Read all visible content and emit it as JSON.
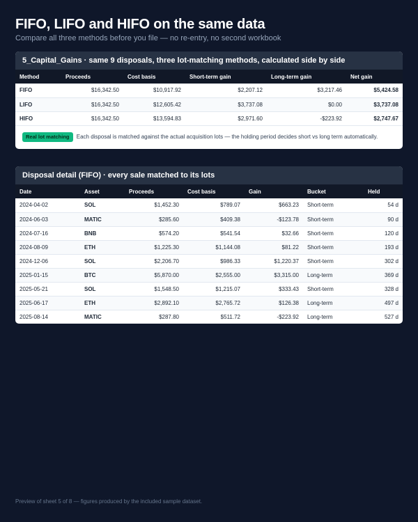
{
  "header": {
    "title": "FIFO, LIFO and HIFO on the same data",
    "subtitle": "Compare all three methods before you file — no re-entry, no second workbook"
  },
  "summary": {
    "heading": "5_Capital_Gains  ·  same 9 disposals, three lot-matching methods, calculated side by side",
    "columns": [
      "Method",
      "Proceeds",
      "Cost basis",
      "Short-term gain",
      "Long-term gain",
      "Net gain"
    ],
    "rows": [
      [
        "FIFO",
        "$16,342.50",
        "$10,917.92",
        "$2,207.12",
        "$3,217.46",
        "$5,424.58"
      ],
      [
        "LIFO",
        "$16,342.50",
        "$12,605.42",
        "$3,737.08",
        "$0.00",
        "$3,737.08"
      ],
      [
        "HIFO",
        "$16,342.50",
        "$13,594.83",
        "$2,971.60",
        "-$223.92",
        "$2,747.67"
      ]
    ],
    "badge": "Real lot matching",
    "note": "Each disposal is matched against the actual acquisition lots — the holding period decides short vs long term automatically."
  },
  "detail": {
    "heading": "Disposal detail (FIFO)  ·  every sale matched to its lots",
    "columns": [
      "Date",
      "Asset",
      "Proceeds",
      "Cost basis",
      "Gain",
      "Bucket",
      "Held"
    ],
    "rows": [
      [
        "2024-04-02",
        "SOL",
        "$1,452.30",
        "$789.07",
        "$663.23",
        "Short-term",
        "54 d"
      ],
      [
        "2024-06-03",
        "MATIC",
        "$285.60",
        "$409.38",
        "-$123.78",
        "Short-term",
        "90 d"
      ],
      [
        "2024-07-16",
        "BNB",
        "$574.20",
        "$541.54",
        "$32.66",
        "Short-term",
        "120 d"
      ],
      [
        "2024-08-09",
        "ETH",
        "$1,225.30",
        "$1,144.08",
        "$81.22",
        "Short-term",
        "193 d"
      ],
      [
        "2024-12-06",
        "SOL",
        "$2,206.70",
        "$986.33",
        "$1,220.37",
        "Short-term",
        "302 d"
      ],
      [
        "2025-01-15",
        "BTC",
        "$5,870.00",
        "$2,555.00",
        "$3,315.00",
        "Long-term",
        "369 d"
      ],
      [
        "2025-05-21",
        "SOL",
        "$1,548.50",
        "$1,215.07",
        "$333.43",
        "Short-term",
        "328 d"
      ],
      [
        "2025-06-17",
        "ETH",
        "$2,892.10",
        "$2,765.72",
        "$126.38",
        "Long-term",
        "497 d"
      ],
      [
        "2025-08-14",
        "MATIC",
        "$287.80",
        "$511.72",
        "-$223.92",
        "Long-term",
        "527 d"
      ]
    ]
  },
  "footer": {
    "text": "Preview of sheet 5 of 8 — figures produced by the included sample dataset."
  },
  "colors": {
    "background": "#0f172a",
    "card_header": "#273244",
    "table_header": "#111827",
    "badge": "#10b981"
  }
}
